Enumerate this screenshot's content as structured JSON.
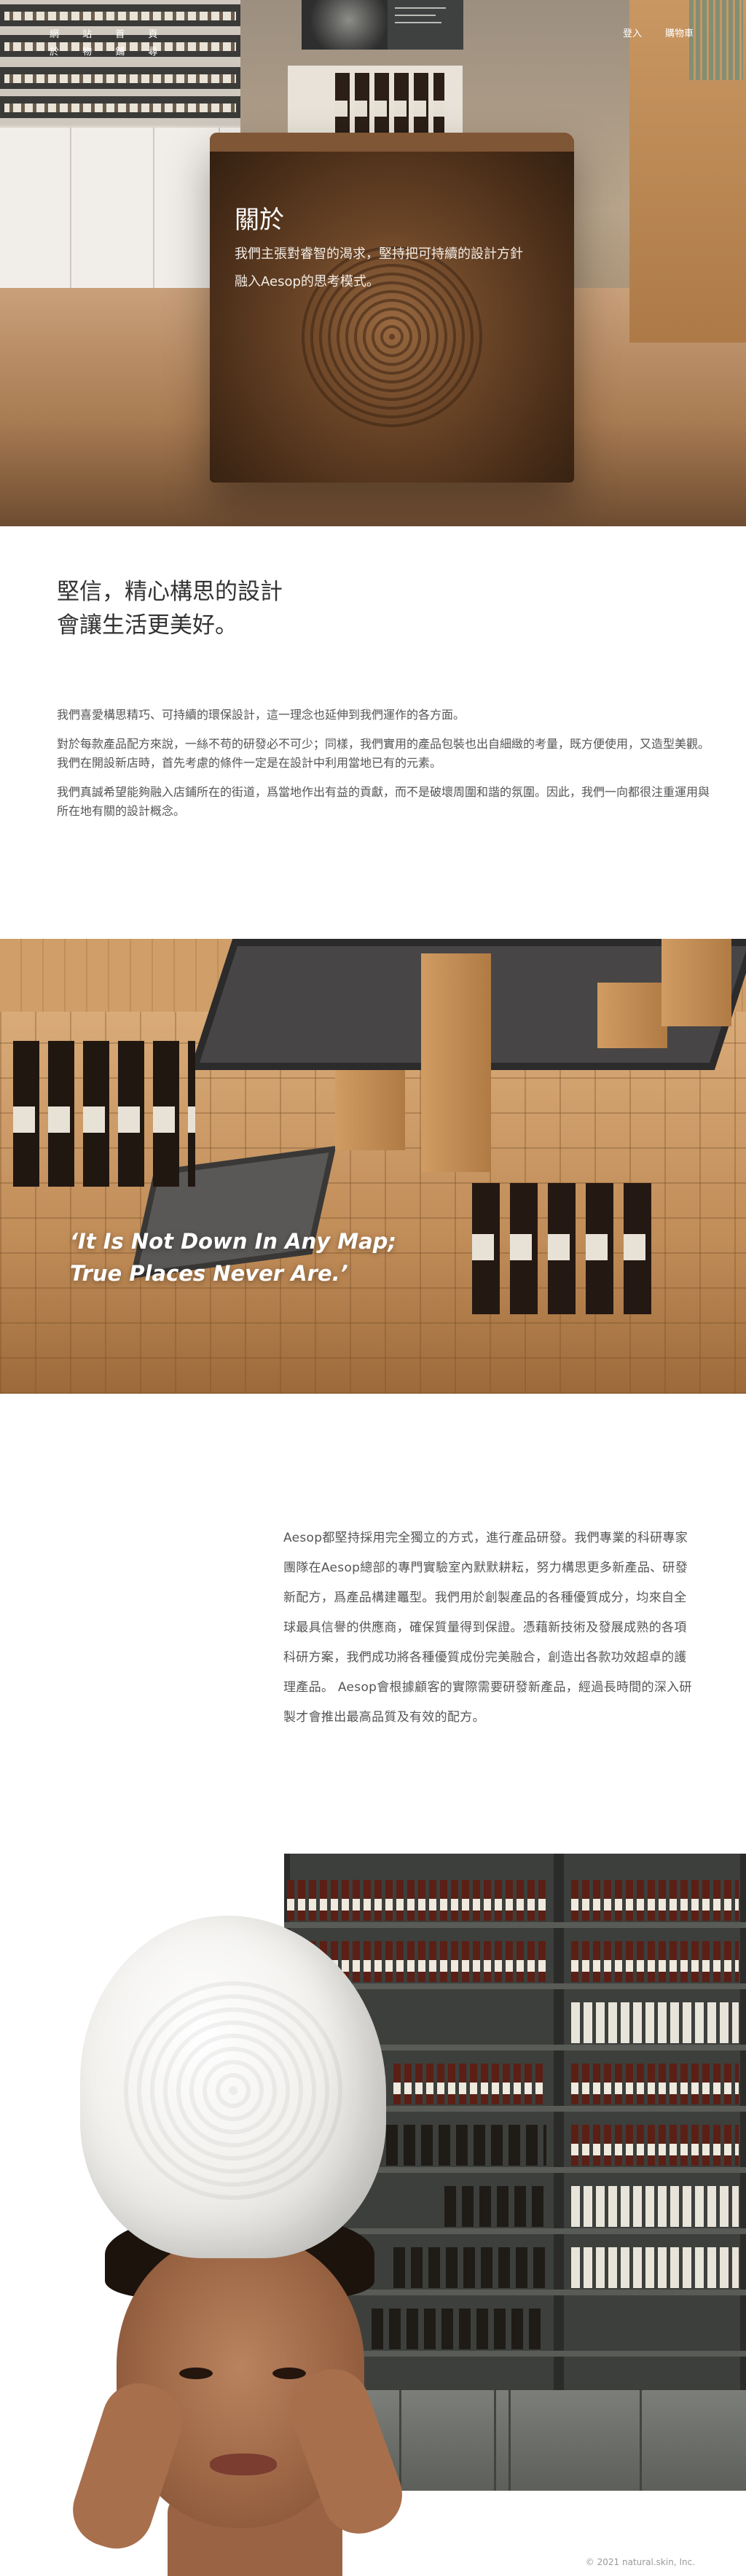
{
  "nav": {
    "brand_line1": "網 站 首 頁",
    "brand_line2": "於 物 鋪 尋",
    "login": "登入",
    "cart": "購物車"
  },
  "hero": {
    "title": "關於",
    "description": "我們主張對睿智的渴求，堅持把可持續的設計方針融入Aesop的思考模式。"
  },
  "intro": {
    "heading_line1": "堅信，精心構思的設計",
    "heading_line2": "會讓生活更美好。",
    "paragraphs": [
      "我們喜愛構思精巧、可持續的環保設計，這一理念也延伸到我們運作的各方面。",
      "對於每款產品配方來說，一絲不苟的研發必不可少；同樣，我們實用的產品包裝也出自細緻的考量，既方便使用，又造型美觀。我們在開設新店時，首先考慮的條件一定是在設計中利用當地已有的元素。",
      "我們真誠希望能夠融入店鋪所在的街道，爲當地作出有益的貢獻，而不是破壞周圍和諧的氛圍。因此，我們一向都很注重運用與所在地有關的設計概念。"
    ]
  },
  "quote": {
    "line1": "‘It Is Not Down In Any Map;",
    "line2": "True Places Never Are.’"
  },
  "research": {
    "text": "Aesop都堅持採用完全獨立的方式，進行產品研發。我們專業的科研專家團隊在Aesop總部的專門實驗室內默默耕耘，努力構思更多新產品、研發新配方，爲產品構建鼉型。我們用於創製產品的各種優質成分，均來自全球最具信譽的供應商，確保質量得到保證。憑藉新技術及發展成熟的各項科研方案，我們成功將各種優質成份完美融合，創造出各款功效超卓的護理產品。 Aesop會根據顧客的實際需要研發新產品，經過長時間的深入研製才會推出最高品質及有效的配方。"
  },
  "footer": {
    "copyright": "© 2021 natural.skin, Inc."
  },
  "colors": {
    "hero_text": "#ffffff",
    "body_text": "#555555",
    "heading_text": "#333333"
  }
}
